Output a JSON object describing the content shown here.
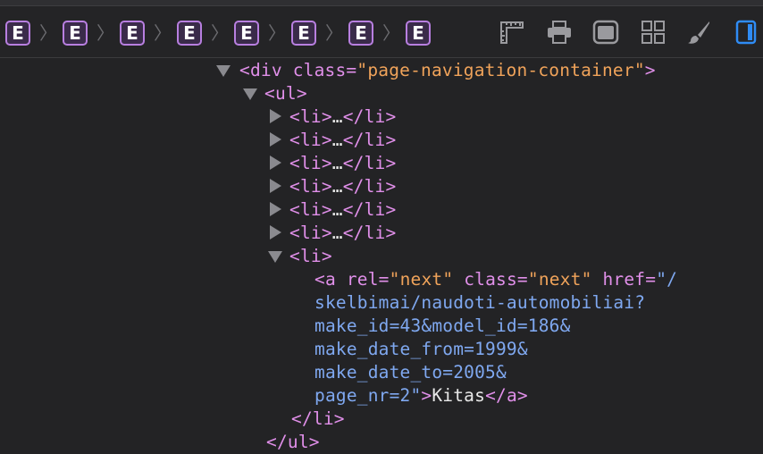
{
  "breadcrumbs": [
    {
      "label": "E"
    },
    {
      "label": "E"
    },
    {
      "label": "E"
    },
    {
      "label": "E"
    },
    {
      "label": "E"
    },
    {
      "label": "E"
    },
    {
      "label": "E"
    },
    {
      "label": "E"
    }
  ],
  "breadcrumb_separator": "〉",
  "toolbar": {
    "icons": [
      "ruler-icon",
      "printer-icon",
      "window-icon",
      "grid-icon",
      "paintbrush-icon",
      "sidebar-toggle-icon"
    ],
    "accent_color": "#2f8cf5"
  },
  "dom": {
    "div_open": "<div",
    "div_attr": "class",
    "div_value": "\"page-navigation-container\"",
    "div_close": ">",
    "ul_open": "<ul>",
    "collapsed_li": [
      "<li>",
      "<li>",
      "<li>",
      "<li>",
      "<li>",
      "<li>"
    ],
    "collapsed_ellipsis": "…",
    "collapsed_li_close": "</li>",
    "li_open": "<li>",
    "a_open": "<a",
    "a_rel_attr": "rel",
    "a_rel_value": "\"next\"",
    "a_class_attr": "class",
    "a_class_value": "\"next\"",
    "a_href_attr": "href",
    "href_lines": [
      "\"/",
      "skelbimai/naudoti-automobiliai?",
      "make_id=43&model_id=186&",
      "make_date_from=1999&",
      "make_date_to=2005&",
      "page_nr=2\""
    ],
    "a_close_bracket": ">",
    "a_text": "Kitas",
    "a_end": "</a>",
    "li_end": "</li>",
    "ul_end": "</ul>"
  }
}
